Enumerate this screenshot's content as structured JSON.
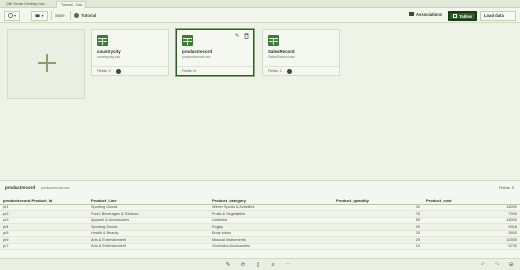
{
  "browser": {
    "tabs": [
      {
        "label": "Qlik Sense Desktop hub"
      },
      {
        "label": "Tutorial - Dat..."
      }
    ]
  },
  "toolbar": {
    "save_label": "Save",
    "app_name": "Tutorial",
    "associations_label": "Associations",
    "tables_label": "Tables",
    "load_data_label": "Load data"
  },
  "cards": [
    {
      "title": "countrycity",
      "file": "countrycity.csv",
      "fields": "Fields: 2"
    },
    {
      "title": "productrecord",
      "file": "productrecord.csv",
      "fields": "Fields: 6"
    },
    {
      "title": "SalesRecord",
      "file": "SalesRecord.csv",
      "fields": "Fields: 2"
    }
  ],
  "preview": {
    "table_name": "productrecord",
    "file_name": "productrecord.csv",
    "fields_count": "Fields: 5",
    "columns": [
      "productrecord.Product_Id",
      "Product_Line",
      "Product_category",
      "Product_quantity",
      "Product_cost"
    ],
    "rows": [
      [
        "pr1",
        "Sporting Goods",
        "Winter Sports & Activities",
        "34",
        "18000"
      ],
      [
        "pr2",
        "Food, Beverages & Tobacco",
        "Fruits & Vegetables",
        "76",
        "7000"
      ],
      [
        "pr3",
        "Apparel & Accessories",
        "Uniforms",
        "59",
        "18000"
      ],
      [
        "pr4",
        "Sporting Goods",
        "Rugby",
        "25",
        "8318"
      ],
      [
        "pr5",
        "Health & Beauty",
        "Body lotion",
        "33",
        "5500"
      ],
      [
        "pr6",
        "Arts & Entertainment",
        "Musical Instruments",
        "29",
        "10000"
      ],
      [
        "pr7",
        "Arts & Entertainment",
        "Orchestra Accessories",
        "10",
        "6700"
      ]
    ]
  },
  "colors": {
    "accent": "#2e5a2a",
    "table_icon": "#3f7a36",
    "background": "#eef3e8"
  }
}
